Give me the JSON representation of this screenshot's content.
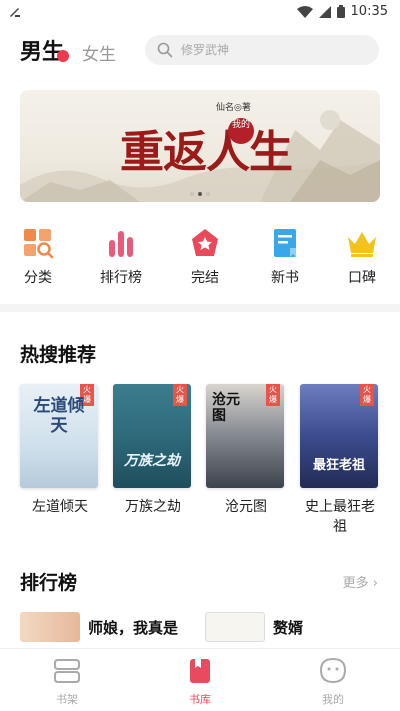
{
  "status_bar": {
    "time": "10:35"
  },
  "header": {
    "tab_male": "男生",
    "tab_female": "女生",
    "search_placeholder": "修罗武神"
  },
  "banner": {
    "author": "仙名◎著",
    "title": "重返人生",
    "seal": "我的",
    "slides": 3,
    "active_slide": 1
  },
  "categories": [
    {
      "label": "分类",
      "icon": "grid-category-icon",
      "color": "#f08a4b"
    },
    {
      "label": "排行榜",
      "icon": "bar-chart-icon",
      "color": "#ea5a7a"
    },
    {
      "label": "完结",
      "icon": "star-badge-icon",
      "color": "#e9495a"
    },
    {
      "label": "新书",
      "icon": "new-book-icon",
      "color": "#3aa8e8"
    },
    {
      "label": "口碑",
      "icon": "crown-icon",
      "color": "#f5c21b"
    }
  ],
  "hot_search": {
    "title": "热搜推荐",
    "badge": "火爆",
    "books": [
      {
        "name": "左道倾天",
        "cover_text": "左道倾天",
        "has_badge": true
      },
      {
        "name": "万族之劫",
        "cover_text": "万族之劫",
        "has_badge": true
      },
      {
        "name": "沧元图",
        "cover_text": "沧元图",
        "has_badge": true
      },
      {
        "name": "史上最狂老祖",
        "cover_text": "最狂老祖",
        "has_badge": true
      }
    ]
  },
  "ranking": {
    "title": "排行榜",
    "more": "更多 ›",
    "items": [
      {
        "name": "师娘，我真是"
      },
      {
        "name": "赘婿"
      }
    ]
  },
  "bottom_nav": [
    {
      "label": "书架",
      "icon": "bookshelf-icon",
      "active": false
    },
    {
      "label": "书库",
      "icon": "library-icon",
      "active": true
    },
    {
      "label": "我的",
      "icon": "profile-icon",
      "active": false
    }
  ],
  "colors": {
    "accent": "#e84a5f",
    "tab_dot": "#f0394e"
  }
}
